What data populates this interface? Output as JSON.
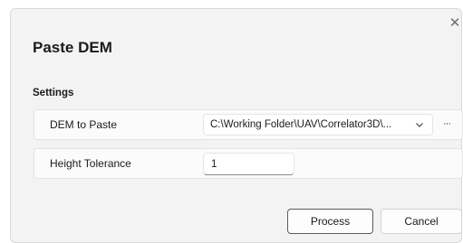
{
  "dialog": {
    "title": "Paste DEM",
    "close_icon": "close-icon",
    "section_title": "Settings"
  },
  "fields": {
    "dem": {
      "label": "DEM to Paste",
      "value": "C:\\Working Folder\\UAV\\Correlator3D\\...",
      "dropdown_icon": "chevron-down-icon",
      "browse_label": "···"
    },
    "height_tolerance": {
      "label": "Height Tolerance",
      "value": "1"
    }
  },
  "buttons": {
    "process_label": "Process",
    "cancel_label": "Cancel"
  }
}
